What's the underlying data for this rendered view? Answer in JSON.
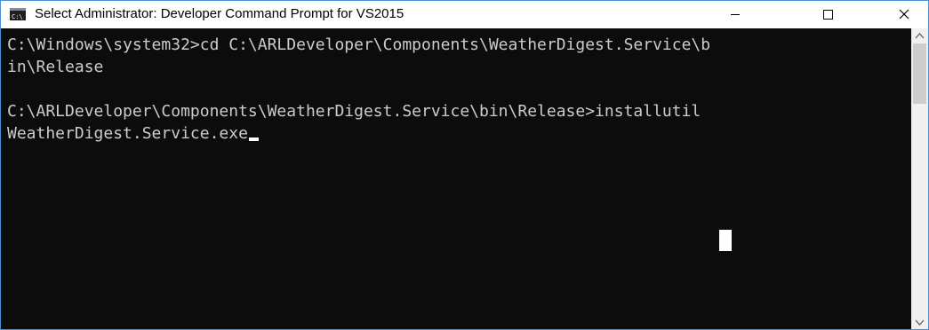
{
  "window": {
    "title": "Select Administrator: Developer Command Prompt for VS2015",
    "icon": "cmd-icon",
    "controls": {
      "minimize_icon": "minimize-icon",
      "maximize_icon": "maximize-icon",
      "close_icon": "close-icon"
    }
  },
  "console": {
    "lines": [
      "C:\\Windows\\system32>cd C:\\ARLDeveloper\\Components\\WeatherDigest.Service\\b",
      "in\\Release",
      "",
      "C:\\ARLDeveloper\\Components\\WeatherDigest.Service\\bin\\Release>installutil",
      "WeatherDigest.Service.exe"
    ],
    "colors": {
      "background": "#0c0c0c",
      "text": "#cccccc",
      "cursor": "#ffffff"
    }
  },
  "scrollbar": {
    "up_icon": "chevron-up-icon",
    "down_icon": "chevron-down-icon"
  }
}
